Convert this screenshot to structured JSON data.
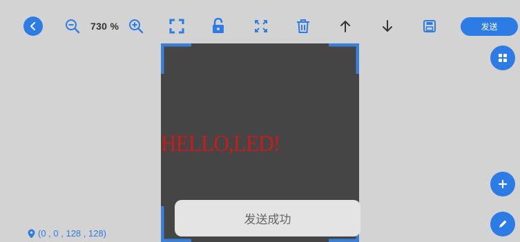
{
  "toolbar": {
    "zoom_level": "730 %",
    "send_label": "发送"
  },
  "canvas": {
    "led_text": "HELLO,LED!"
  },
  "toast": {
    "message": "发送成功"
  },
  "status": {
    "coords": "(0 , 0 , 128 , 128)"
  },
  "colors": {
    "accent": "#2d7be5",
    "canvas_bg": "#454545",
    "led_text": "#cc1a1a",
    "page_bg": "#d3d3d3"
  },
  "icons": [
    "back-icon",
    "zoom-out-icon",
    "zoom-in-icon",
    "fit-frame-icon",
    "lock-icon",
    "expand-icon",
    "trash-icon",
    "arrow-up-icon",
    "arrow-down-icon",
    "save-icon",
    "grid-icon",
    "plus-icon",
    "pencil-icon",
    "location-pin-icon"
  ]
}
